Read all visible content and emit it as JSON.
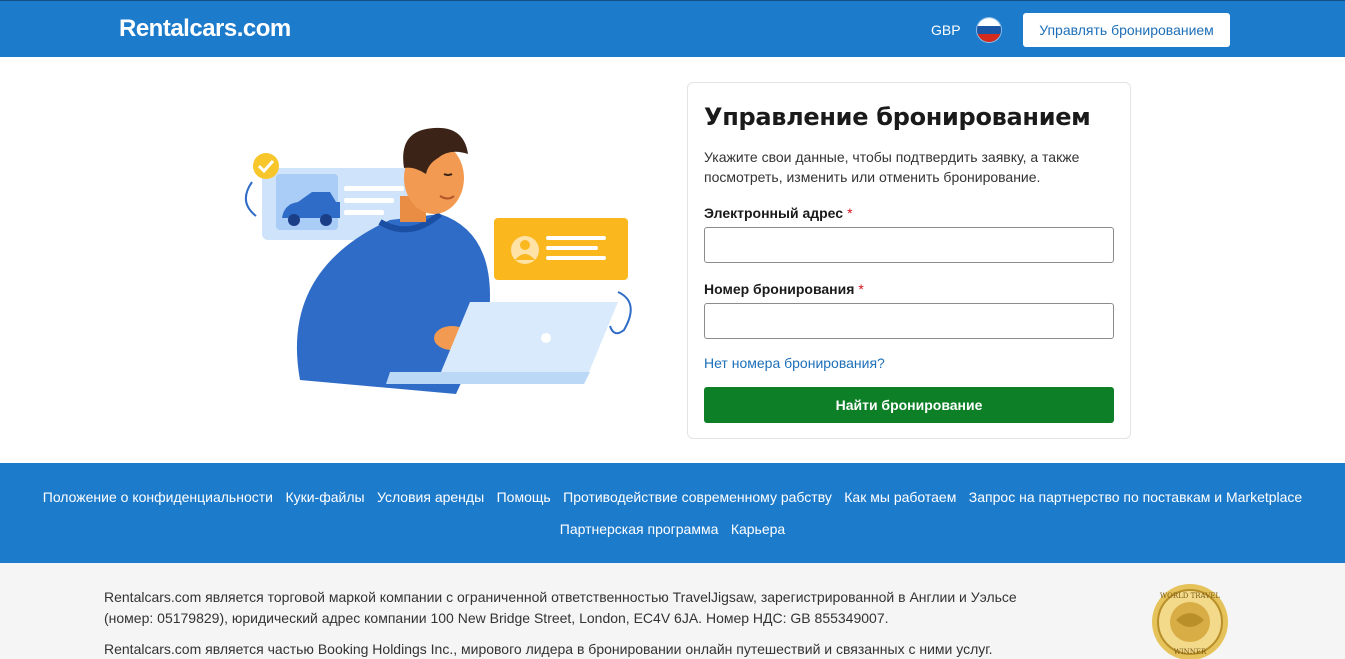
{
  "header": {
    "logo": "Rentalcars.com",
    "currency": "GBP",
    "language_flag": "russia-flag-icon",
    "manage_button": "Управлять бронированием"
  },
  "form": {
    "title": "Управление бронированием",
    "description": "Укажите свои данные, чтобы подтвердить заявку, а также посмотреть, изменить или отменить бронирование.",
    "email_label": "Электронный адрес",
    "email_value": "",
    "booking_label": "Номер бронирования",
    "booking_value": "",
    "required_mark": "*",
    "no_number_link": "Нет номера бронирования?",
    "submit_button": "Найти бронирование"
  },
  "footer": {
    "links_row1": [
      "Положение о конфиденциальности",
      "Куки-файлы",
      "Условия аренды",
      "Помощь",
      "Противодействие современному рабству",
      "Как мы работаем",
      "Запрос на партнерство по поставкам и Marketplace"
    ],
    "links_row2": [
      "Партнерская программа",
      "Карьера"
    ],
    "legal_text_1": "Rentalcars.com является торговой маркой компании с ограниченной ответственностью TravelJigsaw, зарегистрированной в Англии и Уэльсе (номер: 05179829), юридический адрес компании 100 New Bridge Street, London, EC4V 6JA. Номер НДС: GB 855349007.",
    "legal_text_2": "Rentalcars.com является частью Booking Holdings Inc., мирового лидера в бронировании онлайн путешествий и связанных с ними услуг.",
    "award_text": "WORLD TRAVEL AWARDS WINNER"
  },
  "colors": {
    "brand_blue": "#1d7bcc",
    "primary_green": "#0d7f26",
    "link_blue": "#1d6fb8",
    "required_red": "#d4111e"
  }
}
